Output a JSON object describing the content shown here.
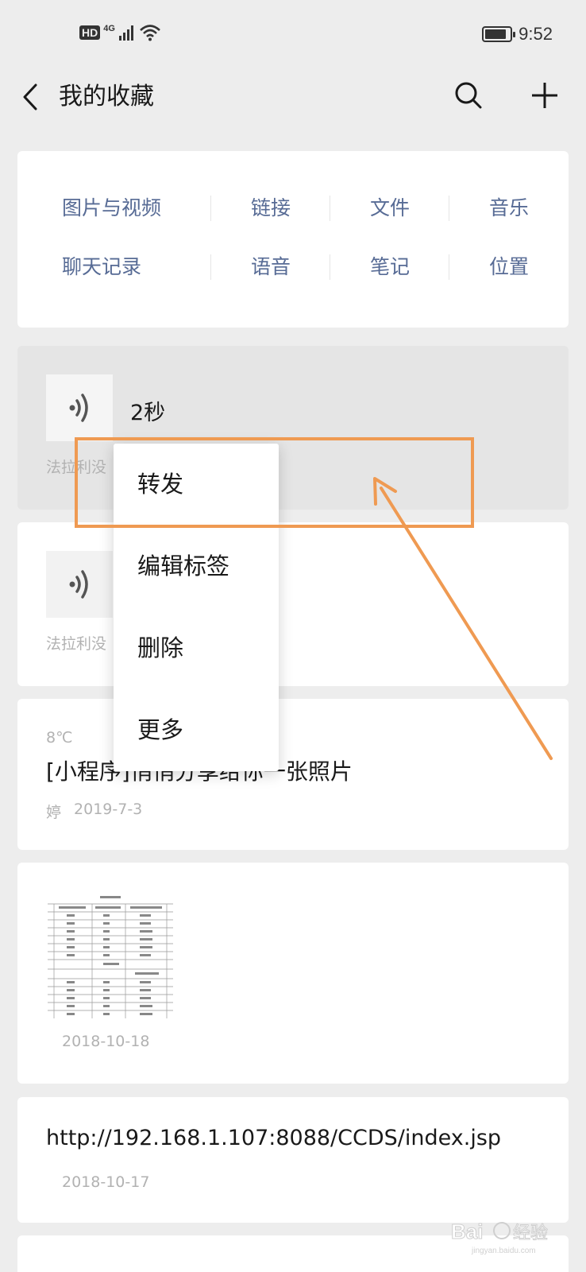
{
  "status_bar": {
    "hd": "HD",
    "network": "4G",
    "battery_level": 0.85,
    "time": "9:52"
  },
  "nav": {
    "title": "我的收藏",
    "back_icon": "chevron-left-icon",
    "search_icon": "search-icon",
    "add_icon": "plus-icon"
  },
  "categories": {
    "row1": [
      "图片与视频",
      "链接",
      "文件",
      "音乐"
    ],
    "row2": [
      "聊天记录",
      "语音",
      "笔记",
      "位置"
    ]
  },
  "favorites": {
    "voice1": {
      "duration": "2秒",
      "source": "法拉利没"
    },
    "voice2": {
      "source": "法拉利没"
    },
    "mini_program": {
      "temp": "8℃",
      "title": "[小程序]悄悄分享给你一张照片",
      "author": "婷",
      "date": "2019-7-3"
    },
    "sheet": {
      "date": "2018-10-18"
    },
    "link": {
      "url": "http://192.168.1.107:8088/CCDS/index.jsp",
      "date": "2018-10-17"
    }
  },
  "context_menu": {
    "items": [
      "转发",
      "编辑标签",
      "删除",
      "更多"
    ]
  },
  "annotation": {
    "color": "#ef9a52"
  },
  "colors": {
    "link_blue": "#576b95",
    "page_bg": "#ededed"
  }
}
